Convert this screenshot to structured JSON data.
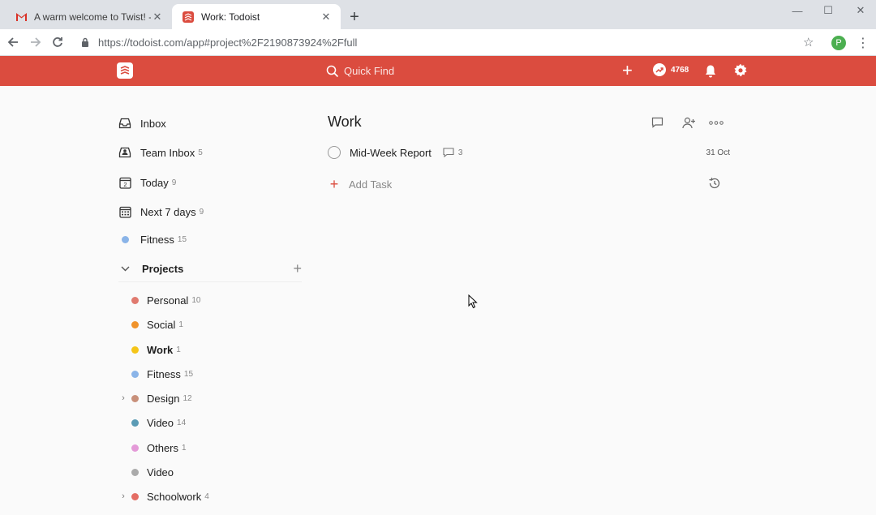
{
  "browser": {
    "tabs": [
      {
        "title": "A warm welcome to Twist! - hcsc",
        "icon": "gmail-icon",
        "active": false
      },
      {
        "title": "Work: Todoist",
        "icon": "todoist-icon",
        "active": true
      }
    ],
    "url": "https://todoist.com/app#project%2F2190873924%2Ffull",
    "profile_initial": "P"
  },
  "topbar": {
    "quick_find_placeholder": "Quick Find",
    "karma": "4768",
    "color": "#db4c3f"
  },
  "sidebar": {
    "filters": [
      {
        "label": "Inbox",
        "count": "",
        "icon": "inbox-icon"
      },
      {
        "label": "Team Inbox",
        "count": "5",
        "icon": "team-inbox-icon"
      },
      {
        "label": "Today",
        "count": "9",
        "icon": "calendar-today-icon",
        "day": "2"
      },
      {
        "label": "Next 7 days",
        "count": "9",
        "icon": "calendar-week-icon"
      },
      {
        "label": "Fitness",
        "count": "15",
        "icon": "dot",
        "color": "#8ab4e8"
      }
    ],
    "projects_label": "Projects",
    "projects": [
      {
        "name": "Personal",
        "count": "10",
        "color": "#e07a6f",
        "expandable": false,
        "active": false
      },
      {
        "name": "Social",
        "count": "1",
        "color": "#f0932b",
        "expandable": false,
        "active": false
      },
      {
        "name": "Work",
        "count": "1",
        "color": "#f5c518",
        "expandable": false,
        "active": true
      },
      {
        "name": "Fitness",
        "count": "15",
        "color": "#8ab4e8",
        "expandable": false,
        "active": false
      },
      {
        "name": "Design",
        "count": "12",
        "color": "#c8907a",
        "expandable": true,
        "active": false
      },
      {
        "name": "Video",
        "count": "14",
        "color": "#5b9bb5",
        "expandable": false,
        "active": false
      },
      {
        "name": "Others",
        "count": "1",
        "color": "#e49ad8",
        "expandable": false,
        "active": false
      },
      {
        "name": "Video",
        "count": "",
        "color": "#aaaaaa",
        "expandable": false,
        "active": false
      },
      {
        "name": "Schoolwork",
        "count": "4",
        "color": "#e46d64",
        "expandable": true,
        "active": false
      }
    ]
  },
  "main": {
    "title": "Work",
    "tasks": [
      {
        "name": "Mid-Week Report",
        "comments": "3",
        "due": "31 Oct"
      }
    ],
    "add_task_label": "Add Task"
  }
}
